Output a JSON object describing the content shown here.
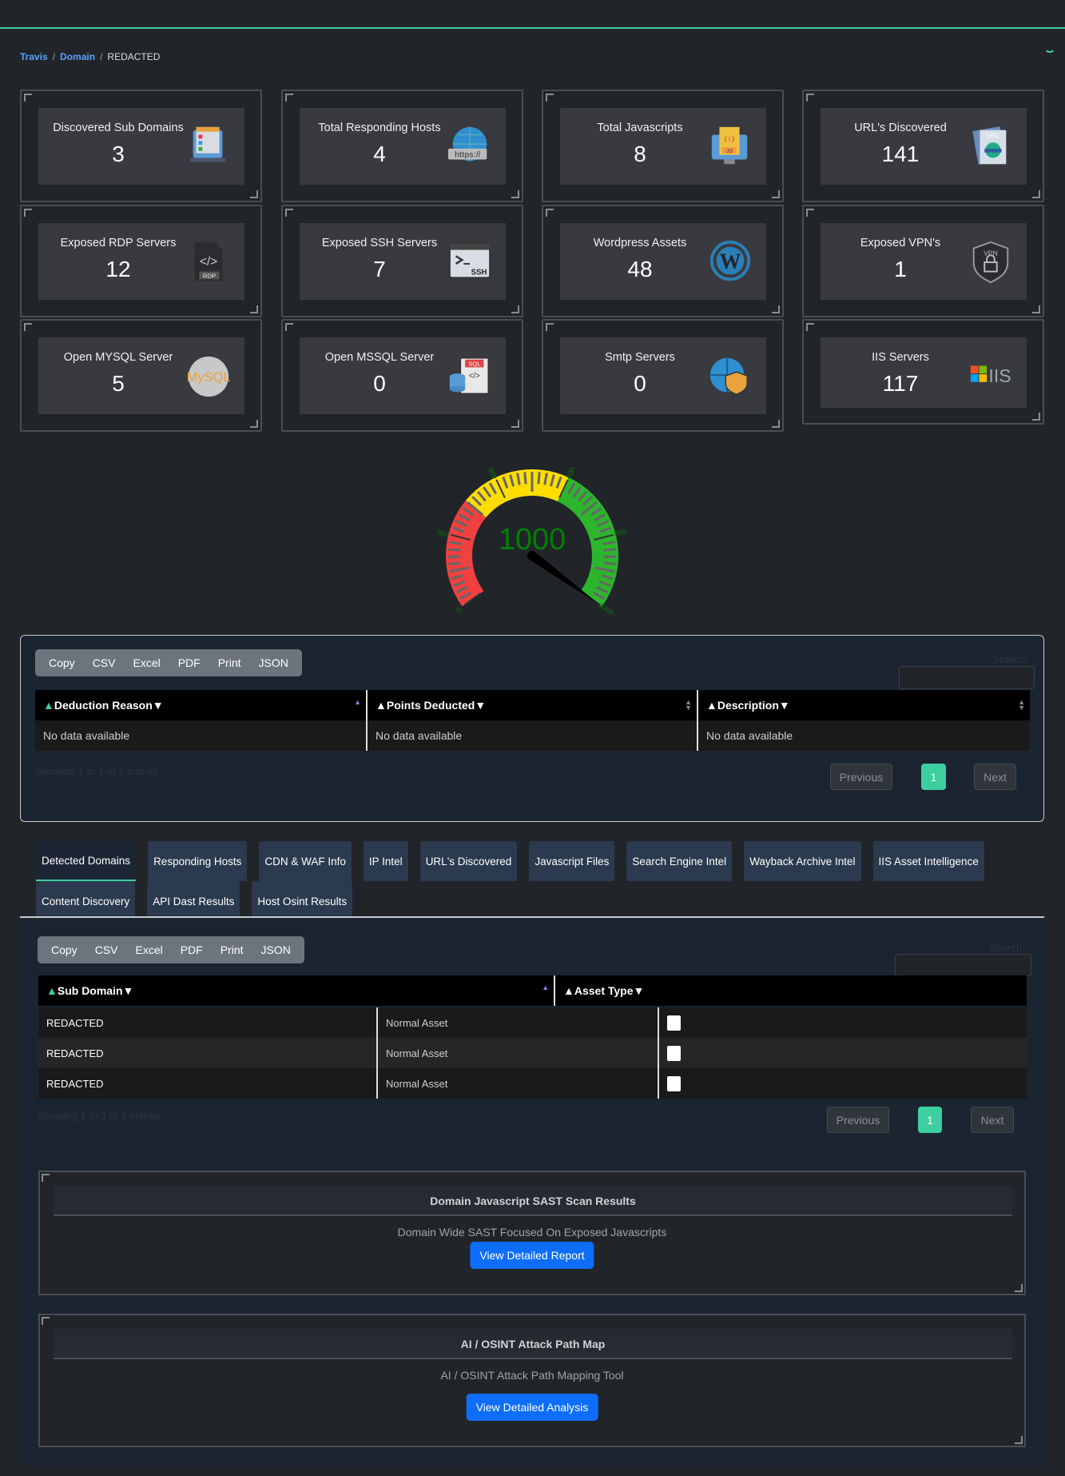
{
  "breadcrumb": {
    "items": [
      "Travis",
      "Domain"
    ],
    "current": "REDACTED"
  },
  "cards": [
    {
      "title": "Discovered Sub Domains",
      "value": "3",
      "icon": "domains-laptop-icon"
    },
    {
      "title": "Total Responding Hosts",
      "value": "4",
      "icon": "https-globe-icon"
    },
    {
      "title": "Total Javascripts",
      "value": "8",
      "icon": "javascript-file-icon"
    },
    {
      "title": "URL's Discovered",
      "value": "141",
      "icon": "url-document-icon"
    },
    {
      "title": "Exposed RDP Servers",
      "value": "12",
      "icon": "rdp-file-icon"
    },
    {
      "title": "Exposed SSH Servers",
      "value": "7",
      "icon": "ssh-terminal-icon"
    },
    {
      "title": "Wordpress Assets",
      "value": "48",
      "icon": "wordpress-icon"
    },
    {
      "title": "Exposed VPN's",
      "value": "1",
      "icon": "vpn-shield-icon"
    },
    {
      "title": "Open MYSQL Server",
      "value": "5",
      "icon": "mysql-icon"
    },
    {
      "title": "Open MSSQL Server",
      "value": "0",
      "icon": "sql-database-icon"
    },
    {
      "title": "Smtp Servers",
      "value": "0",
      "icon": "globe-shield-icon"
    },
    {
      "title": "IIS Servers",
      "value": "117",
      "icon": "iis-logo-icon"
    }
  ],
  "gauge": {
    "value": "1000",
    "min": 0,
    "max": 1000,
    "tick_labels": [
      "0",
      "200",
      "400",
      "600",
      "800",
      "1000"
    ],
    "bands": [
      {
        "from": 0,
        "to": 300,
        "color": "#f04040"
      },
      {
        "from": 300,
        "to": 600,
        "color": "#ffdd00"
      },
      {
        "from": 600,
        "to": 1000,
        "color": "#2db52d"
      }
    ],
    "value_color": "#008000"
  },
  "export_buttons": [
    "Copy",
    "CSV",
    "Excel",
    "PDF",
    "Print",
    "JSON"
  ],
  "search_label": "Search:",
  "deductions": {
    "columns": [
      "Deduction Reason",
      "Points Deducted",
      "Description"
    ],
    "rows": [
      [
        "No data available",
        "No data available",
        "No data available"
      ]
    ],
    "info": "Showing 1 to 1 of 1 entries"
  },
  "pagination": {
    "previous": "Previous",
    "page": "1",
    "next": "Next"
  },
  "tabs": [
    "Detected Domains",
    "Responding Hosts",
    "CDN & WAF Info",
    "IP Intel",
    "URL's Discovered",
    "Javascript Files",
    "Search Engine Intel",
    "Wayback Archive Intel",
    "IIS Asset Intelligence",
    "Content Discovery",
    "API Dast Results",
    "Host Osint Results"
  ],
  "active_tab": "Detected Domains",
  "domains": {
    "columns": [
      "Sub Domain",
      "Asset Type"
    ],
    "rows": [
      [
        "REDACTED",
        "Normal Asset"
      ],
      [
        "REDACTED",
        "Normal Asset"
      ],
      [
        "REDACTED",
        "Normal Asset"
      ]
    ],
    "info": "Showing 1 to 3 of 3 entries"
  },
  "sast": {
    "title": "Domain Javascript SAST Scan Results",
    "subtitle": "Domain Wide SAST Focused On Exposed Javascripts",
    "button": "View Detailed Report"
  },
  "osint": {
    "title": "AI / OSINT Attack Path Map",
    "subtitle": "AI / OSINT Attack Path Mapping Tool",
    "button": "View Detailed Analysis"
  },
  "colors": {
    "accent": "#3ccf9f",
    "primary_button": "#0d6efd",
    "link": "#5aa2ff"
  }
}
